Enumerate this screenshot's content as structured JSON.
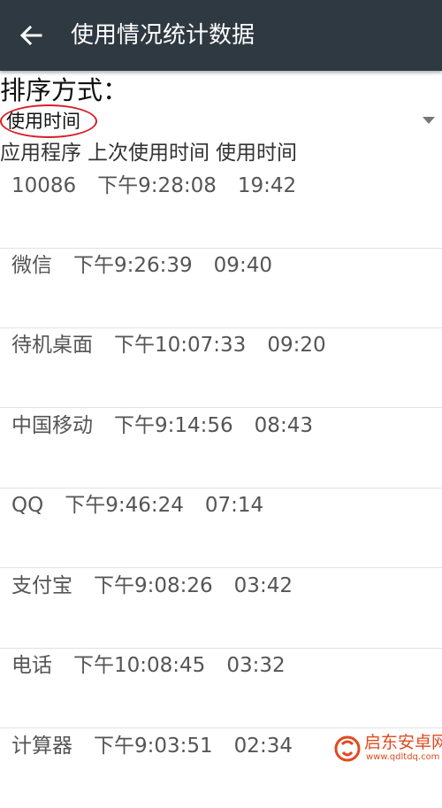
{
  "appbar": {
    "back_icon": "arrow-left-icon",
    "title": "使用情况统计数据",
    "background_color": "#2f3942"
  },
  "sort": {
    "label": "排序方式：",
    "selected_value": "使用时间",
    "caret_icon": "chevron-down-icon",
    "highlight_color": "#d81f26"
  },
  "columns": [
    "应用程序",
    "上次使用时间",
    "使用时间"
  ],
  "usage_rows": [
    {
      "app": "10086",
      "last_used": "下午9:28:08",
      "duration": "19:42"
    },
    {
      "app": "微信",
      "last_used": "下午9:26:39",
      "duration": "09:40"
    },
    {
      "app": "待机桌面",
      "last_used": "下午10:07:33",
      "duration": "09:20"
    },
    {
      "app": "中国移动",
      "last_used": "下午9:14:56",
      "duration": "08:43"
    },
    {
      "app": "QQ",
      "last_used": "下午9:46:24",
      "duration": "07:14"
    },
    {
      "app": "支付宝",
      "last_used": "下午9:08:26",
      "duration": "03:42"
    },
    {
      "app": "电话",
      "last_used": "下午10:08:45",
      "duration": "03:32"
    },
    {
      "app": "计算器",
      "last_used": "下午9:03:51",
      "duration": "02:34"
    }
  ],
  "watermark": {
    "name": "启东安卓网",
    "url": "www.qdltdq.com",
    "logo_icon": "site-logo-icon",
    "color": "#e04a1f"
  }
}
